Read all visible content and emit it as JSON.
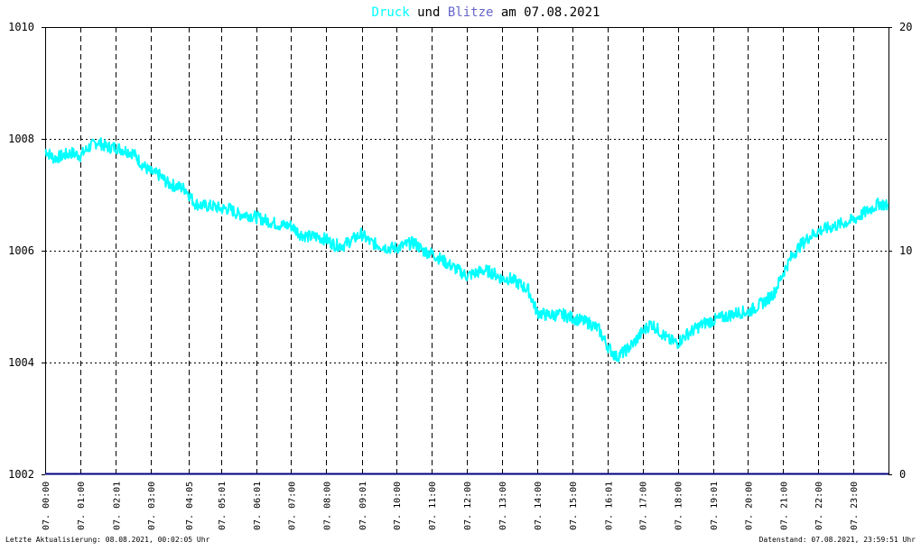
{
  "title": {
    "part1": "Druck",
    "part2": " und ",
    "part3": "Blitze",
    "part4": " am 07.08.2021"
  },
  "footer": {
    "left": "Letzte Aktualisierung: 08.08.2021, 00:02:05 Uhr",
    "right": "Datenstand: 07.08.2021, 23:59:51 Uhr"
  },
  "colors": {
    "druck": "#00ffff",
    "blitze": "#6666cc",
    "blitze_line": "#000080",
    "grid": "#000000"
  },
  "chart_data": {
    "type": "line",
    "title": "Druck und Blitze am 07.08.2021",
    "xlabel": "",
    "ylabel": "",
    "ylim_left": [
      1002,
      1010
    ],
    "ylim_right": [
      0,
      20
    ],
    "yticks_left": [
      1002,
      1004,
      1006,
      1008,
      1010
    ],
    "yticks_right": [
      0,
      10,
      20
    ],
    "grid": true,
    "x_labels": [
      "07. 00:00",
      "07. 01:00",
      "07. 02:01",
      "07. 03:00",
      "07. 04:05",
      "07. 05:01",
      "07. 06:01",
      "07. 07:00",
      "07. 08:00",
      "07. 09:01",
      "07. 10:00",
      "07. 11:00",
      "07. 12:00",
      "07. 13:00",
      "07. 14:00",
      "07. 15:00",
      "07. 16:01",
      "07. 17:00",
      "07. 18:00",
      "07. 19:01",
      "07. 20:00",
      "07. 21:00",
      "07. 22:00",
      "07. 23:00"
    ],
    "x_label_hours": [
      0,
      1,
      2.017,
      3,
      4.083,
      5.017,
      6.017,
      7,
      8,
      9.017,
      10,
      11,
      12,
      13,
      14,
      15,
      16.017,
      17,
      18,
      19.017,
      20,
      21,
      22,
      23
    ],
    "series": [
      {
        "name": "Druck",
        "axis": "left",
        "x_hours": [
          0,
          0.25,
          0.5,
          0.75,
          1.0,
          1.25,
          1.5,
          1.75,
          2.0,
          2.25,
          2.5,
          2.75,
          3.0,
          3.25,
          3.5,
          3.75,
          4.0,
          4.25,
          4.5,
          4.75,
          5.0,
          5.25,
          5.5,
          5.75,
          6.0,
          6.25,
          6.5,
          6.75,
          7.0,
          7.25,
          7.5,
          7.75,
          8.0,
          8.25,
          8.5,
          8.75,
          9.0,
          9.25,
          9.5,
          9.75,
          10.0,
          10.25,
          10.5,
          10.75,
          11.0,
          11.25,
          11.5,
          11.75,
          12.0,
          12.25,
          12.5,
          12.75,
          13.0,
          13.25,
          13.5,
          13.75,
          14.0,
          14.25,
          14.5,
          14.75,
          15.0,
          15.25,
          15.5,
          15.75,
          16.0,
          16.25,
          16.5,
          16.75,
          17.0,
          17.25,
          17.5,
          17.75,
          18.0,
          18.25,
          18.5,
          18.75,
          19.0,
          19.25,
          19.5,
          19.75,
          20.0,
          20.25,
          20.5,
          20.75,
          21.0,
          21.25,
          21.5,
          21.75,
          22.0,
          22.25,
          22.5,
          22.75,
          23.0,
          23.25,
          23.5,
          23.75,
          23.99
        ],
        "values": [
          1007.8,
          1007.65,
          1007.7,
          1007.75,
          1007.7,
          1007.85,
          1007.95,
          1007.85,
          1007.85,
          1007.8,
          1007.75,
          1007.55,
          1007.4,
          1007.35,
          1007.2,
          1007.15,
          1007.1,
          1006.85,
          1006.8,
          1006.8,
          1006.75,
          1006.75,
          1006.65,
          1006.65,
          1006.6,
          1006.55,
          1006.5,
          1006.45,
          1006.45,
          1006.3,
          1006.25,
          1006.25,
          1006.2,
          1006.1,
          1006.1,
          1006.2,
          1006.3,
          1006.15,
          1006.1,
          1006.05,
          1006.05,
          1006.1,
          1006.15,
          1006.0,
          1005.95,
          1005.85,
          1005.75,
          1005.65,
          1005.55,
          1005.6,
          1005.65,
          1005.6,
          1005.5,
          1005.5,
          1005.4,
          1005.3,
          1004.9,
          1004.85,
          1004.85,
          1004.85,
          1004.8,
          1004.75,
          1004.7,
          1004.6,
          1004.3,
          1004.1,
          1004.2,
          1004.35,
          1004.55,
          1004.7,
          1004.55,
          1004.4,
          1004.35,
          1004.5,
          1004.6,
          1004.7,
          1004.75,
          1004.8,
          1004.85,
          1004.9,
          1004.9,
          1005.0,
          1005.1,
          1005.25,
          1005.6,
          1005.9,
          1006.1,
          1006.25,
          1006.35,
          1006.4,
          1006.45,
          1006.5,
          1006.55,
          1006.65,
          1006.75,
          1006.85,
          1006.8
        ]
      },
      {
        "name": "Blitze",
        "axis": "right",
        "x_hours": [
          0,
          24
        ],
        "values": [
          0,
          0
        ]
      }
    ]
  }
}
